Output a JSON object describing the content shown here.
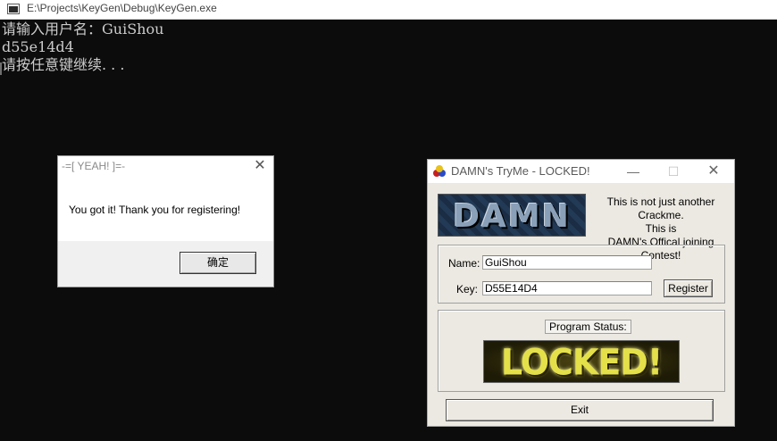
{
  "console": {
    "title": "E:\\Projects\\KeyGen\\Debug\\KeyGen.exe",
    "lines": [
      "请输入用户名：GuiShou",
      "d55e14d4",
      "请按任意键继续. . ."
    ]
  },
  "message_box": {
    "title": "-=[ YEAH! ]=-",
    "message": "You got it! Thank you for registering!",
    "ok_label": "确定"
  },
  "tryme": {
    "title": "DAMN's TryMe - LOCKED!",
    "logo_text": "DAMN",
    "intro_lines": [
      "This is not just another Crackme.",
      "This is",
      "DAMN's Offical joining Contest!"
    ],
    "name_label": "Name:",
    "name_value": "GuiShou",
    "key_label": "Key:",
    "key_value": "D55E14D4",
    "register_label": "Register",
    "status_label": "Program Status:",
    "status_value": "LOCKED!",
    "exit_label": "Exit"
  },
  "icons": [
    "console-app-icon",
    "close-icon",
    "minimize-icon",
    "maximize-icon",
    "damn-app-icon"
  ]
}
